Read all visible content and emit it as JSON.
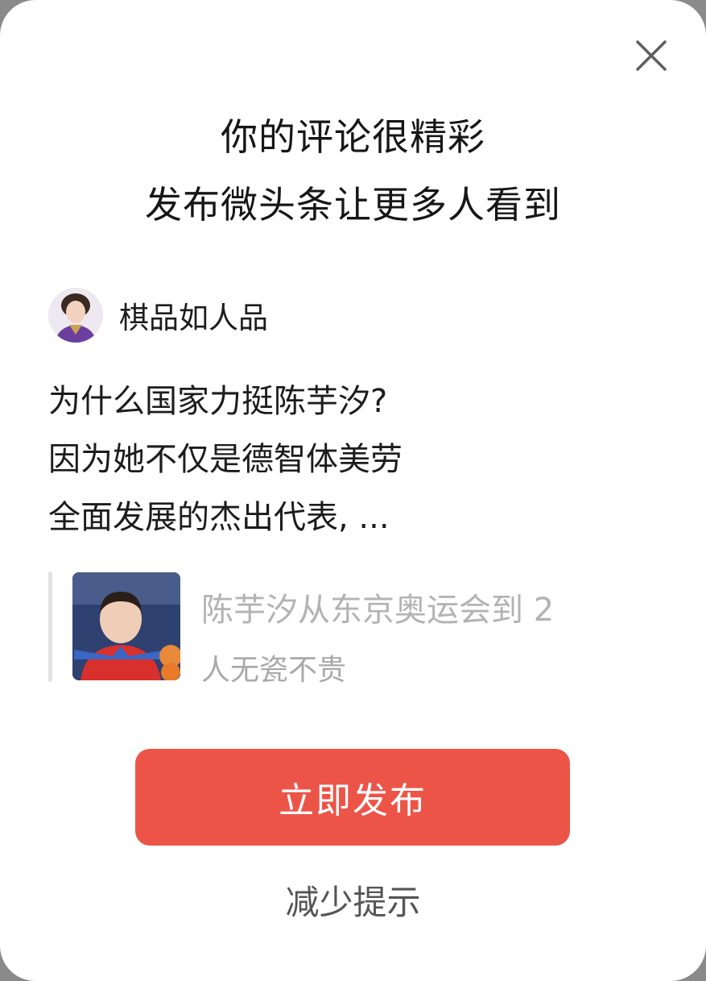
{
  "dialog": {
    "headline_line1": "你的评论很精彩",
    "headline_line2": "发布微头条让更多人看到",
    "close_icon": "close-icon"
  },
  "author": {
    "name": "棋品如人品",
    "avatar": "avatar"
  },
  "comment": {
    "lines": [
      "为什么国家力挺陈芋汐?",
      "因为她不仅是德智体美劳",
      "全面发展的杰出代表, ..."
    ]
  },
  "quote": {
    "title": "陈芋汐从东京奥运会到 2",
    "source": "人无瓷不贵"
  },
  "actions": {
    "publish_label": "立即发布",
    "reduce_label": "减少提示"
  },
  "colors": {
    "accent": "#ec5448",
    "background": "#ffffff",
    "muted_text": "#b3b3b3"
  }
}
